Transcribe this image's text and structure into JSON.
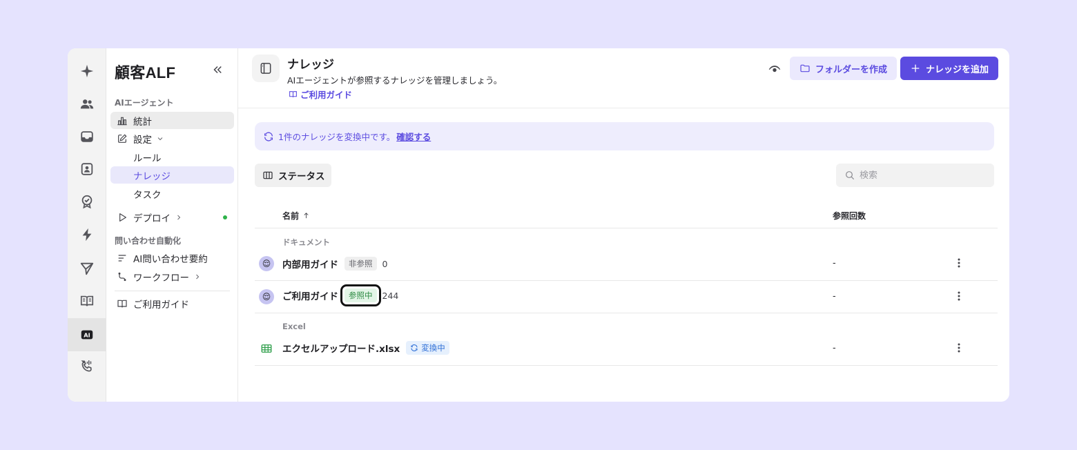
{
  "app": {
    "brand": "顧客ALF"
  },
  "sidebar": {
    "sections": [
      "AIエージェント",
      "問い合わせ自動化"
    ],
    "items": {
      "stats": "統計",
      "settings": "設定",
      "rules": "ルール",
      "knowledge": "ナレッジ",
      "tasks": "タスク",
      "deploy": "デプロイ",
      "ai_summary": "AI問い合わせ要約",
      "workflow": "ワークフロー",
      "guide": "ご利用ガイド"
    }
  },
  "header": {
    "title": "ナレッジ",
    "subtitle": "AIエージェントが参照するナレッジを管理しましょう。",
    "guide_link": "ご利用ガイド",
    "create_folder_label": "フォルダーを作成",
    "add_knowledge_label": "ナレッジを追加"
  },
  "banner": {
    "text": "1件のナレッジを変換中です。",
    "link": "確認する"
  },
  "toolbar": {
    "status_label": "ステータス",
    "search_placeholder": "検索"
  },
  "table": {
    "columns": {
      "name": "名前",
      "ref_count": "参照回数"
    },
    "groups": [
      {
        "label": "ドキュメント",
        "rows": [
          {
            "name": "内部用ガイド",
            "badge": "非参照",
            "count": "0",
            "ref": "-"
          },
          {
            "name": "ご利用ガイド",
            "badge": "参照中",
            "count": "244",
            "ref": "-"
          }
        ]
      },
      {
        "label": "Excel",
        "rows": [
          {
            "name": "エクセルアップロード.xlsx",
            "badge": "変換中",
            "ref": "-"
          }
        ]
      }
    ]
  },
  "colors": {
    "accent": "#5b4be0",
    "background": "#e5e3fe",
    "success": "#2eb24a",
    "info": "#2f6fd6"
  },
  "rail_icons": [
    "sparkle-icon",
    "users-icon",
    "inbox-icon",
    "contact-card-icon",
    "badge-check-icon",
    "lightning-icon",
    "send-icon",
    "book-icon",
    "ai-icon",
    "phone-icon"
  ]
}
